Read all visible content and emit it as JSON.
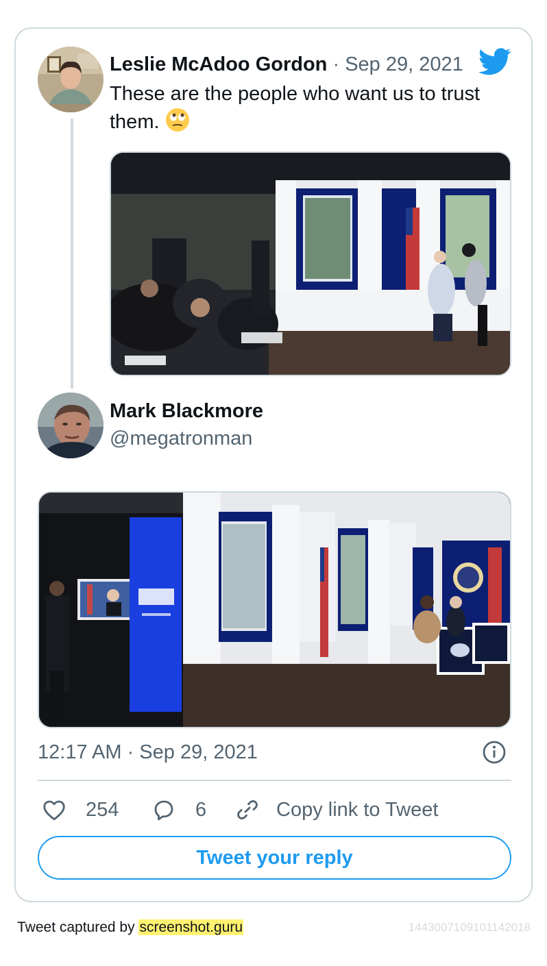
{
  "quoted_tweet": {
    "author_name": "Leslie McAdoo Gordon",
    "separator": "·",
    "date": "Sep 29, 2021",
    "text": "These are the people who want us to trust them.",
    "emoji": "face-with-rolling-eyes"
  },
  "main_tweet": {
    "author_name": "Mark Blackmore",
    "handle": "@megatronman",
    "timestamp": "12:17 AM · Sep 29, 2021"
  },
  "actions": {
    "likes": "254",
    "replies": "6",
    "copy_link_label": "Copy link to Tweet"
  },
  "reply_button_label": "Tweet your reply",
  "footer": {
    "captured_by_text": "Tweet captured by",
    "brand": "screenshot.guru",
    "tweet_id": "1443007109101142018"
  },
  "colors": {
    "accent": "#1d9bf0",
    "secondary_text": "#536471",
    "border": "#cfd9de",
    "highlight": "#fff270"
  },
  "icons": [
    "twitter-bird-icon",
    "info-icon",
    "heart-icon",
    "reply-bubble-icon",
    "link-icon",
    "rolling-eyes-emoji"
  ]
}
